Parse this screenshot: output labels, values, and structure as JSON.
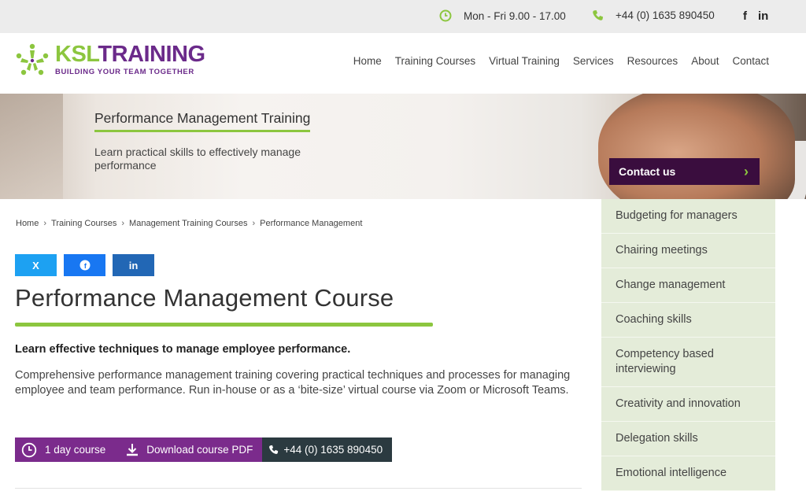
{
  "topbar": {
    "hours": "Mon - Fri 9.00 - 17.00",
    "phone": "+44 (0) 1635 890450",
    "social": [
      "f",
      "in"
    ]
  },
  "logo": {
    "ksl": "KSL",
    "training": "TRAINING",
    "tagline": "BUILDING YOUR TEAM TOGETHER"
  },
  "nav": [
    "Home",
    "Training Courses",
    "Virtual Training",
    "Services",
    "Resources",
    "About",
    "Contact"
  ],
  "hero": {
    "title": "Performance Management Training",
    "subtitle": "Learn practical skills to effectively manage performance",
    "contact_label": "Contact us"
  },
  "breadcrumb": [
    "Home",
    "Training Courses",
    "Management Training Courses",
    "Performance Management"
  ],
  "share": {
    "x": "X",
    "facebook": "f",
    "linkedin": "in"
  },
  "main": {
    "title": "Performance Management Course",
    "lead": "Learn effective techniques to manage employee performance.",
    "description": "Comprehensive performance management training covering practical techniques and processes for managing employee and team performance. Run in-house or as a ‘bite-size’ virtual course via Zoom or Microsoft Teams.",
    "duration": "1 day course",
    "download": "Download course PDF",
    "phone": "+44 (0) 1635 890450"
  },
  "sidebar": [
    "Budgeting for managers",
    "Chairing meetings",
    "Change management",
    "Coaching skills",
    "Competency based interviewing",
    "Creativity and innovation",
    "Delegation skills",
    "Emotional intelligence"
  ],
  "colors": {
    "green": "#8cc63f",
    "purple": "#7b2b8c",
    "dark_purple": "#3a0d3e",
    "sidebar_bg": "#e4ecd9"
  }
}
